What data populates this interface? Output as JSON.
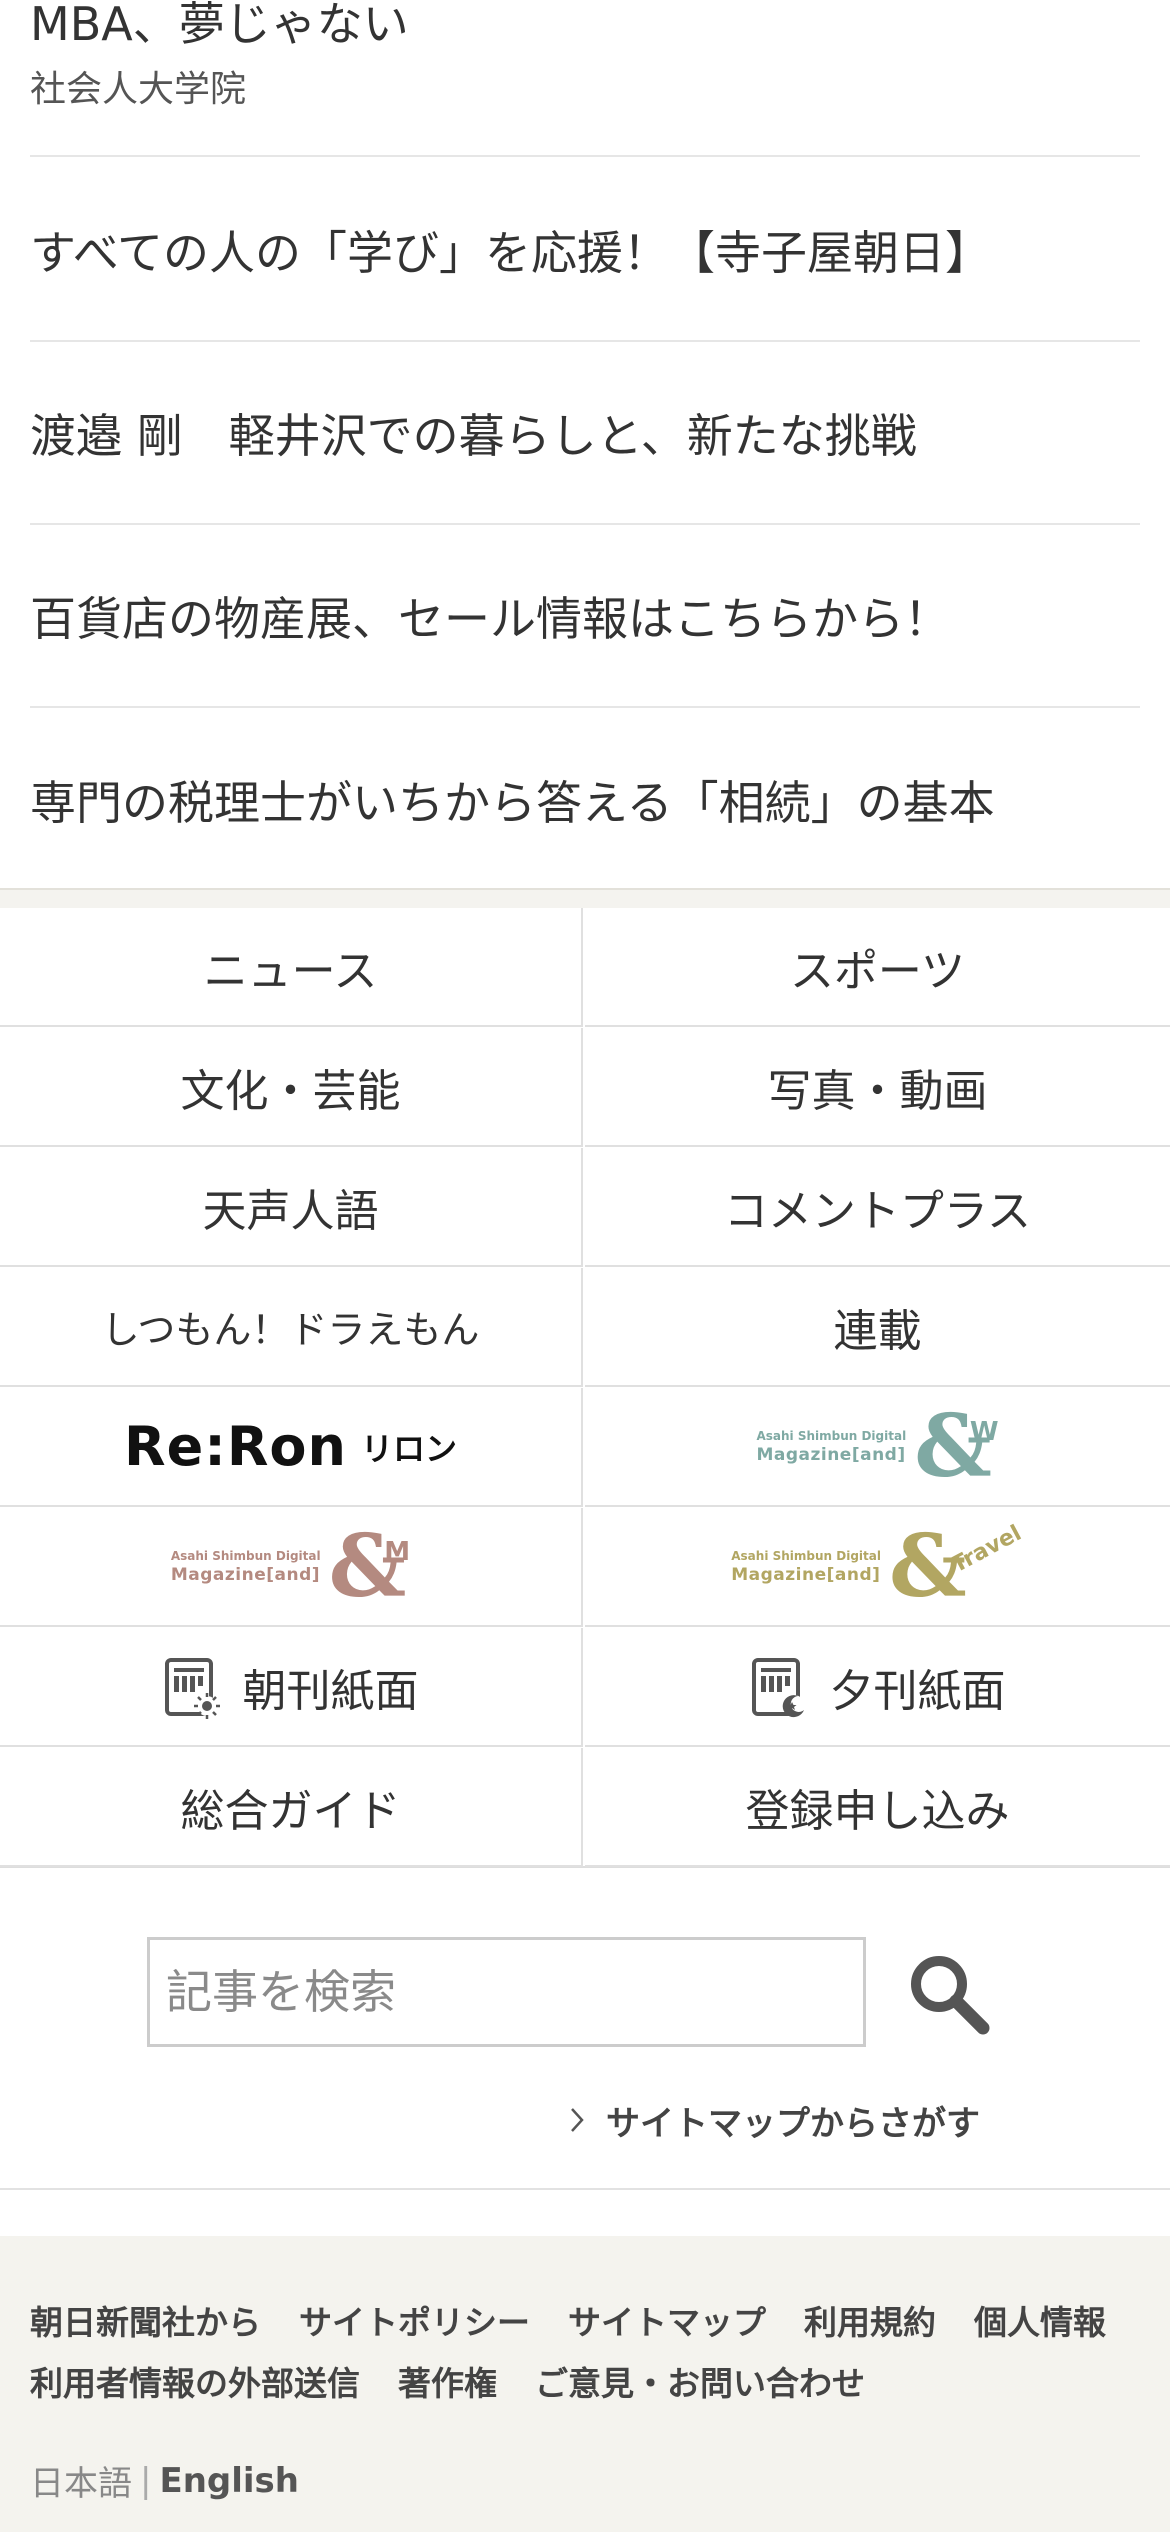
{
  "promos": {
    "top": {
      "title": "MBA、夢じゃない",
      "subtitle": "社会人大学院"
    },
    "items": [
      "すべての人の「学び」を応援！【寺子屋朝日】",
      "渡邉 剛　軽井沢での暮らしと、新たな挑戦",
      "百貨店の物産展、セール情報はこちらから！",
      "専門の税理士がいちから答える「相続」の基本"
    ]
  },
  "nav": {
    "news": "ニュース",
    "sports": "スポーツ",
    "culture": "文化・芸能",
    "photo_video": "写真・動画",
    "tensei": "天声人語",
    "comment_plus": "コメントプラス",
    "shitsumon": "しつもん！ドラえもん",
    "rensai": "連載",
    "reron": {
      "word": "Re:Ron",
      "kana": "リロン"
    },
    "and_w": {
      "line1": "Asahi Shimbun Digital",
      "line2": "Magazine[and]",
      "mark": "W",
      "color": "#7fa9a3"
    },
    "and_m": {
      "line1": "Asahi Shimbun Digital",
      "line2": "Magazine[and]",
      "mark": "M",
      "color": "#b48a80"
    },
    "and_travel": {
      "line1": "Asahi Shimbun Digital",
      "line2": "Magazine[and]",
      "mark": "Travel",
      "color": "#b2a662"
    },
    "morning_paper": "朝刊紙面",
    "evening_paper": "夕刊紙面",
    "guide": "総合ガイド",
    "signup": "登録申し込み"
  },
  "search": {
    "placeholder": "記事を検索",
    "sitemap_link": "サイトマップからさがす"
  },
  "footer": {
    "links_row1": [
      "朝日新聞社から",
      "サイトポリシー",
      "サイトマップ",
      "利用規約",
      "個人情報"
    ],
    "links_row2": [
      "利用者情報の外部送信",
      "著作権",
      "ご意見・お問い合わせ"
    ],
    "lang_ja": "日本語",
    "lang_sep": "|",
    "lang_en": "English"
  },
  "colors": {
    "text": "#333333",
    "footer_bg": "#f4f3ee",
    "border": "#e0e0e0"
  }
}
